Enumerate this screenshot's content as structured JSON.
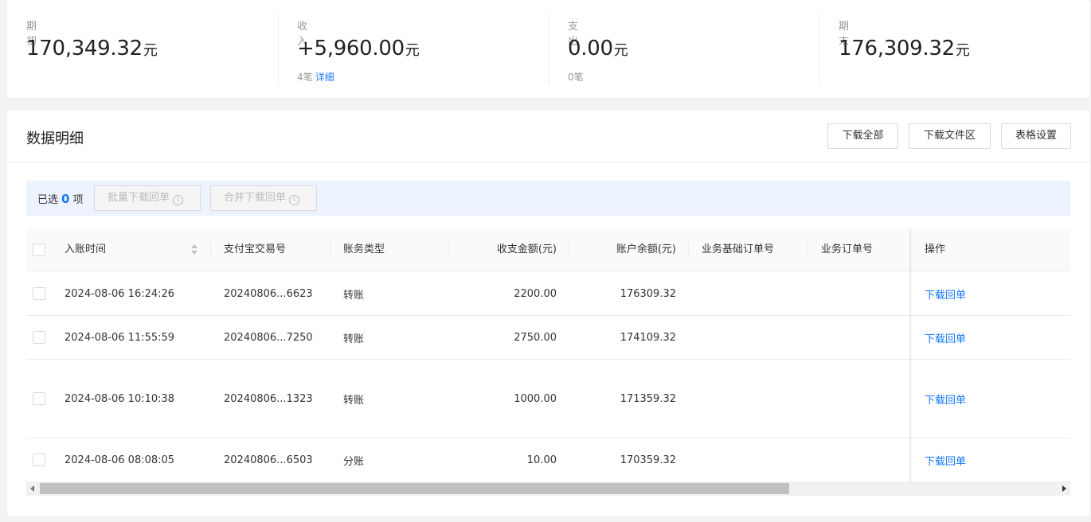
{
  "summary": {
    "opening": {
      "label": "期初",
      "value": "170,349.32",
      "unit": "元"
    },
    "income": {
      "label": "收入",
      "value": "+5,960.00",
      "unit": "元",
      "count": "4笔",
      "detail_link": "详细"
    },
    "expense": {
      "label": "支出",
      "value": "0.00",
      "unit": "元",
      "count": "0笔"
    },
    "closing": {
      "label": "期末",
      "value": "176,309.32",
      "unit": "元"
    }
  },
  "detail": {
    "title": "数据明细",
    "buttons": {
      "download_all": "下载全部",
      "download_folder": "下载文件区",
      "table_settings": "表格设置"
    },
    "selection": {
      "prefix": "已选",
      "count": "0",
      "suffix": "项",
      "batch_download": "批量下载回单",
      "merge_download": "合并下载回单"
    },
    "columns": [
      "入账时间",
      "支付宝交易号",
      "账务类型",
      "收支金额(元)",
      "账户余额(元)",
      "业务基础订单号",
      "业务订单号",
      "操作"
    ],
    "rows": [
      {
        "time": "2024-08-06 16:24:26",
        "trade_no": "20240806...6623",
        "type": "转账",
        "amount": "2200.00",
        "balance": "176309.32",
        "base_order": "",
        "order": "",
        "action": "下载回单"
      },
      {
        "time": "2024-08-06 11:55:59",
        "trade_no": "20240806...7250",
        "type": "转账",
        "amount": "2750.00",
        "balance": "174109.32",
        "base_order": "",
        "order": "",
        "action": "下载回单"
      },
      {
        "time": "2024-08-06 10:10:38",
        "trade_no": "20240806...1323",
        "type": "转账",
        "amount": "1000.00",
        "balance": "171359.32",
        "base_order": "",
        "order": "",
        "action": "下载回单"
      },
      {
        "time": "2024-08-06 08:08:05",
        "trade_no": "20240806...6503",
        "type": "分账",
        "amount": "10.00",
        "balance": "170359.32",
        "base_order": "",
        "order": "",
        "action": "下载回单"
      }
    ]
  },
  "icons": {
    "info": "info-circle-icon",
    "sort": "sort-icon",
    "checkbox": "checkbox-icon"
  },
  "colors": {
    "accent": "#1677ff",
    "selection_bar": "#ecf3ff",
    "background": "#f2f3f5"
  }
}
